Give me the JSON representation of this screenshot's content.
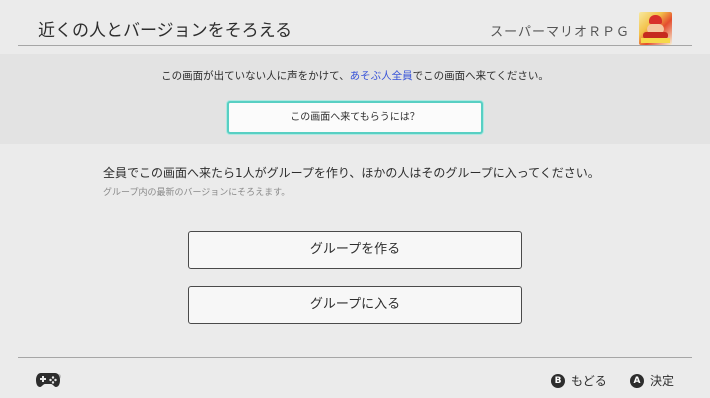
{
  "header": {
    "title": "近くの人とバージョンをそろえる",
    "game_name": "スーパーマリオＲＰＧ",
    "game_icon": "super-mario-rpg-icon"
  },
  "instruction": {
    "before": "この画面が出ていない人に声をかけて、",
    "link": "あそぶ人全員",
    "after": "でこの画面へ来てください。"
  },
  "howto_button": "この画面へ来てもらうには？",
  "main_text": "全員でこの画面へ来たら1人がグループを作り、ほかの人はそのグループに入ってください。",
  "sub_text": "グループ内の最新のバージョンにそろえます。",
  "actions": {
    "create_group": "グループを作る",
    "join_group": "グループに入る"
  },
  "footer": {
    "controller_icon": "controller-icon",
    "back_key": "B",
    "back_label": "もどる",
    "ok_key": "A",
    "ok_label": "決定"
  },
  "colors": {
    "background": "#ebebeb",
    "link": "#3a55d8",
    "focus": "#58cfc3",
    "player_indicator": "#7fcf3c"
  }
}
